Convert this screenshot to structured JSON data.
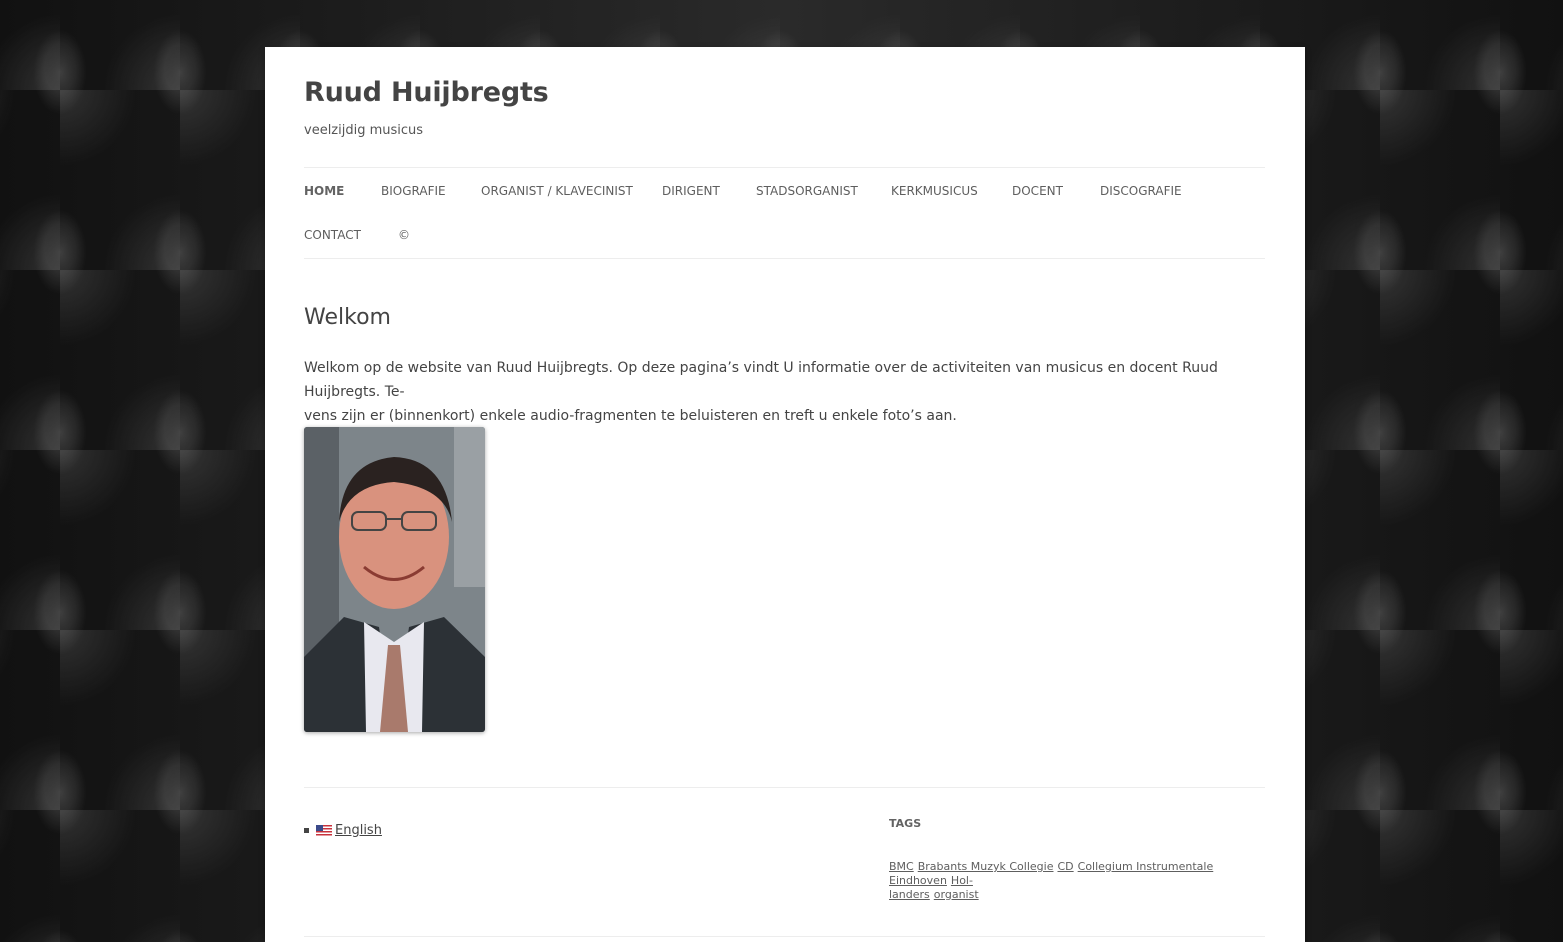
{
  "site": {
    "title": "Ruud Huijbregts",
    "description": "veelzijdig musicus"
  },
  "nav": {
    "items": [
      {
        "label": "HOME",
        "current": true
      },
      {
        "label": "BIOGRAFIE"
      },
      {
        "label": "ORGANIST / KLAVECINIST"
      },
      {
        "label": "DIRIGENT"
      },
      {
        "label": "STADSORGANIST"
      },
      {
        "label": "KERKMUSICUS"
      },
      {
        "label": "DOCENT"
      },
      {
        "label": "DISCOGRAFIE"
      },
      {
        "label": "CONTACT"
      },
      {
        "label": "©"
      }
    ]
  },
  "entry": {
    "title": "Welkom",
    "body_line1": "Welkom op de website van Ruud Huijbregts. Op deze pagina’s vindt U informatie over de activiteiten van musicus en docent Ruud Huijbregts. Te-",
    "body_line2": "vens zijn er (binnenkort) enkele audio-fragmenten te beluisteren en treft u enkele foto’s aan."
  },
  "footer": {
    "language": {
      "label": "English",
      "flag_icon": "us-flag-icon"
    },
    "tags_title": "TAGS",
    "tags": [
      "BMC",
      "Brabants Muzyk Collegie",
      "CD",
      "Collegium Instrumentale Eindhoven",
      "Hol-",
      "landers",
      "organist"
    ]
  }
}
